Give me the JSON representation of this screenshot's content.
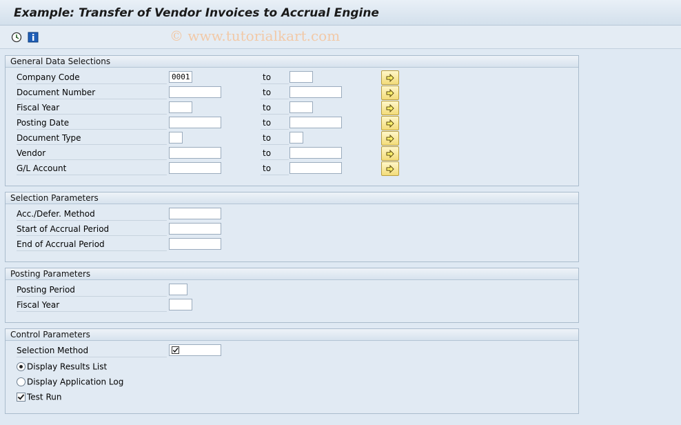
{
  "window": {
    "title": "Example: Transfer of Vendor Invoices to Accrual Engine"
  },
  "toolbar": {
    "buttons": [
      {
        "icon": "execute-clock-icon"
      },
      {
        "icon": "info-icon"
      }
    ]
  },
  "watermark": "© www.tutorialkart.com",
  "general": {
    "title": "General Data Selections",
    "to_label": "to",
    "rows": [
      {
        "label": "Company Code",
        "from": "0001",
        "to": ""
      },
      {
        "label": "Document Number",
        "from": "",
        "to": ""
      },
      {
        "label": "Fiscal Year",
        "from": "",
        "to": ""
      },
      {
        "label": "Posting Date",
        "from": "",
        "to": ""
      },
      {
        "label": "Document Type",
        "from": "",
        "to": ""
      },
      {
        "label": "Vendor",
        "from": "",
        "to": ""
      },
      {
        "label": "G/L Account",
        "from": "",
        "to": ""
      }
    ]
  },
  "selection": {
    "title": "Selection Parameters",
    "rows": [
      {
        "label": "Acc./Defer. Method",
        "value": ""
      },
      {
        "label": "Start of Accrual Period",
        "value": ""
      },
      {
        "label": "End of Accrual Period",
        "value": ""
      }
    ]
  },
  "posting": {
    "title": "Posting Parameters",
    "rows": [
      {
        "label": "Posting Period",
        "value": ""
      },
      {
        "label": "Fiscal Year",
        "value": ""
      }
    ]
  },
  "control": {
    "title": "Control Parameters",
    "selection_method_label": "Selection Method",
    "selection_method_checked": true,
    "options": [
      {
        "label": "Display Results List",
        "selected": true
      },
      {
        "label": "Display Application Log",
        "selected": false
      }
    ],
    "test_run": {
      "label": "Test Run",
      "checked": true
    }
  },
  "colors": {
    "background": "#dfe9f3",
    "multi_button": "#f3dc7a",
    "watermark": "#f2c9a7"
  }
}
